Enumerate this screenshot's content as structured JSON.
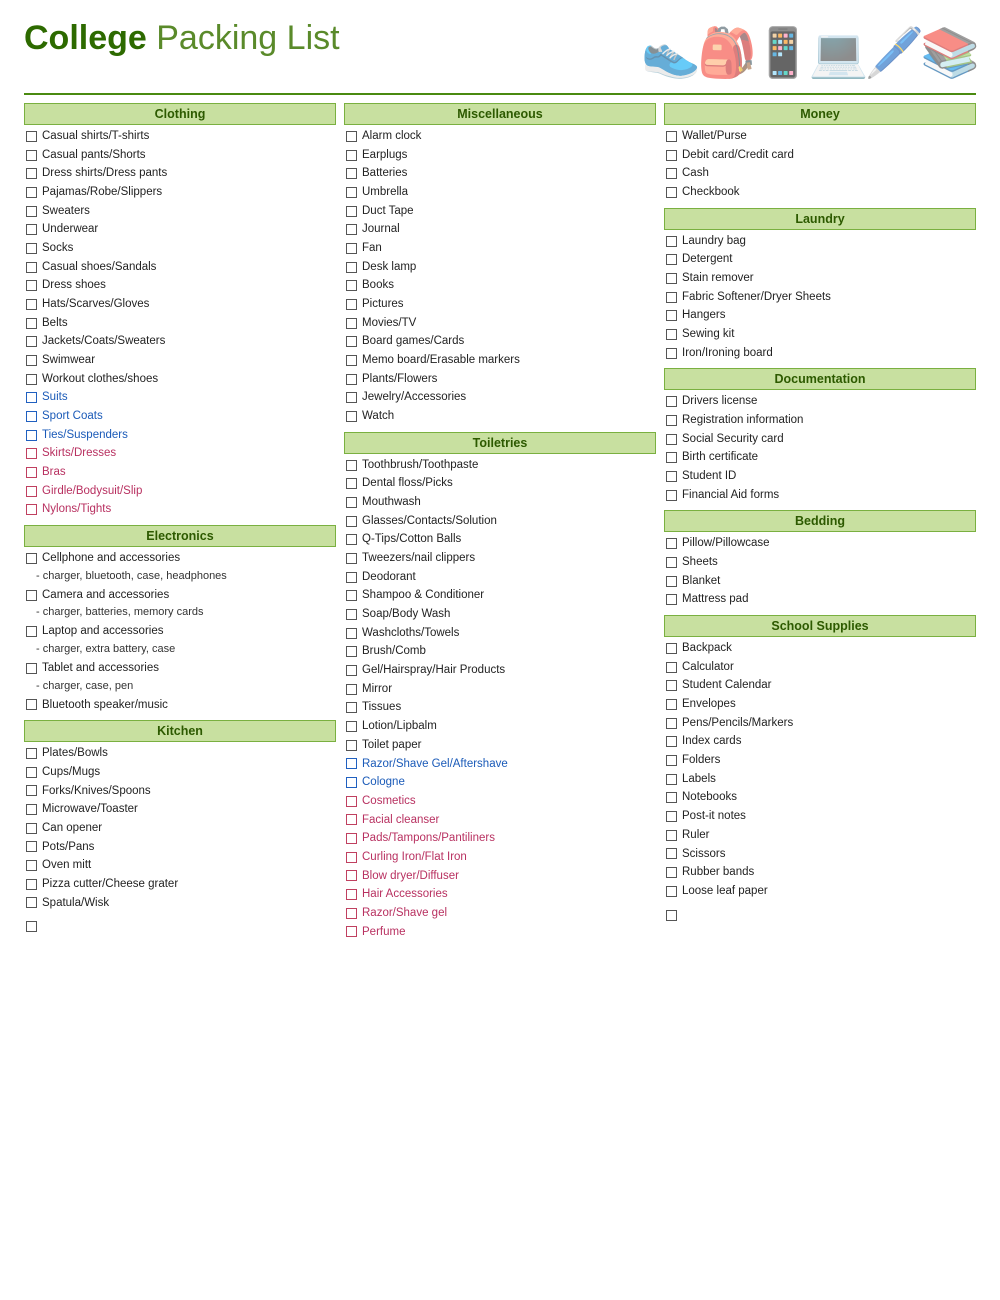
{
  "header": {
    "title_bold": "College",
    "title_light": " Packing List"
  },
  "columns": {
    "col1": {
      "sections": [
        {
          "id": "clothing",
          "header": "Clothing",
          "items": [
            {
              "text": "Casual shirts/T-shirts",
              "style": "normal"
            },
            {
              "text": "Casual pants/Shorts",
              "style": "normal"
            },
            {
              "text": "Dress shirts/Dress pants",
              "style": "normal"
            },
            {
              "text": "Pajamas/Robe/Slippers",
              "style": "normal"
            },
            {
              "text": "Sweaters",
              "style": "normal"
            },
            {
              "text": "Underwear",
              "style": "normal"
            },
            {
              "text": "Socks",
              "style": "normal"
            },
            {
              "text": "Casual shoes/Sandals",
              "style": "normal"
            },
            {
              "text": "Dress shoes",
              "style": "normal"
            },
            {
              "text": "Hats/Scarves/Gloves",
              "style": "normal"
            },
            {
              "text": "Belts",
              "style": "normal"
            },
            {
              "text": "Jackets/Coats/Sweaters",
              "style": "normal"
            },
            {
              "text": "Swimwear",
              "style": "normal"
            },
            {
              "text": "Workout clothes/shoes",
              "style": "normal"
            },
            {
              "text": "Suits",
              "style": "blue"
            },
            {
              "text": "Sport Coats",
              "style": "blue"
            },
            {
              "text": "Ties/Suspenders",
              "style": "blue"
            },
            {
              "text": "Skirts/Dresses",
              "style": "pink"
            },
            {
              "text": "Bras",
              "style": "pink"
            },
            {
              "text": "Girdle/Bodysuit/Slip",
              "style": "pink"
            },
            {
              "text": "Nylons/Tights",
              "style": "pink"
            }
          ]
        },
        {
          "id": "electronics",
          "header": "Electronics",
          "items": [
            {
              "text": "Cellphone and accessories",
              "style": "normal"
            },
            {
              "text": " - charger, bluetooth, case, headphones",
              "style": "indent"
            },
            {
              "text": "Camera and accessories",
              "style": "normal"
            },
            {
              "text": " - charger, batteries, memory cards",
              "style": "indent"
            },
            {
              "text": "Laptop and accessories",
              "style": "normal"
            },
            {
              "text": " - charger, extra battery, case",
              "style": "indent"
            },
            {
              "text": "Tablet and accessories",
              "style": "normal"
            },
            {
              "text": " - charger, case, pen",
              "style": "indent"
            },
            {
              "text": "Bluetooth speaker/music",
              "style": "normal"
            }
          ]
        },
        {
          "id": "kitchen",
          "header": "Kitchen",
          "items": [
            {
              "text": "Plates/Bowls",
              "style": "normal"
            },
            {
              "text": "Cups/Mugs",
              "style": "normal"
            },
            {
              "text": "Forks/Knives/Spoons",
              "style": "normal"
            },
            {
              "text": "Microwave/Toaster",
              "style": "normal"
            },
            {
              "text": "Can opener",
              "style": "normal"
            },
            {
              "text": "Pots/Pans",
              "style": "normal"
            },
            {
              "text": "Oven mitt",
              "style": "normal"
            },
            {
              "text": "Pizza cutter/Cheese grater",
              "style": "normal"
            },
            {
              "text": "Spatula/Wisk",
              "style": "normal"
            }
          ]
        }
      ]
    },
    "col2": {
      "sections": [
        {
          "id": "miscellaneous",
          "header": "Miscellaneous",
          "items": [
            {
              "text": "Alarm clock",
              "style": "normal"
            },
            {
              "text": "Earplugs",
              "style": "normal"
            },
            {
              "text": "Batteries",
              "style": "normal"
            },
            {
              "text": "Umbrella",
              "style": "normal"
            },
            {
              "text": "Duct Tape",
              "style": "normal"
            },
            {
              "text": "Journal",
              "style": "normal"
            },
            {
              "text": "Fan",
              "style": "normal"
            },
            {
              "text": "Desk lamp",
              "style": "normal"
            },
            {
              "text": "Books",
              "style": "normal"
            },
            {
              "text": "Pictures",
              "style": "normal"
            },
            {
              "text": "Movies/TV",
              "style": "normal"
            },
            {
              "text": "Board games/Cards",
              "style": "normal"
            },
            {
              "text": "Memo board/Erasable markers",
              "style": "normal"
            },
            {
              "text": "Plants/Flowers",
              "style": "normal"
            },
            {
              "text": "Jewelry/Accessories",
              "style": "normal"
            },
            {
              "text": "Watch",
              "style": "normal"
            }
          ]
        },
        {
          "id": "toiletries",
          "header": "Toiletries",
          "items": [
            {
              "text": "Toothbrush/Toothpaste",
              "style": "normal"
            },
            {
              "text": "Dental floss/Picks",
              "style": "normal"
            },
            {
              "text": "Mouthwash",
              "style": "normal"
            },
            {
              "text": "Glasses/Contacts/Solution",
              "style": "normal"
            },
            {
              "text": "Q-Tips/Cotton Balls",
              "style": "normal"
            },
            {
              "text": "Tweezers/nail clippers",
              "style": "normal"
            },
            {
              "text": "Deodorant",
              "style": "normal"
            },
            {
              "text": "Shampoo & Conditioner",
              "style": "normal"
            },
            {
              "text": "Soap/Body Wash",
              "style": "normal"
            },
            {
              "text": "Washcloths/Towels",
              "style": "normal"
            },
            {
              "text": "Brush/Comb",
              "style": "normal"
            },
            {
              "text": "Gel/Hairspray/Hair Products",
              "style": "normal"
            },
            {
              "text": "Mirror",
              "style": "normal"
            },
            {
              "text": "Tissues",
              "style": "normal"
            },
            {
              "text": "Lotion/Lipbalm",
              "style": "normal"
            },
            {
              "text": "Toilet paper",
              "style": "normal"
            },
            {
              "text": "Razor/Shave Gel/Aftershave",
              "style": "blue"
            },
            {
              "text": "Cologne",
              "style": "blue"
            },
            {
              "text": "Cosmetics",
              "style": "pink"
            },
            {
              "text": "Facial cleanser",
              "style": "pink"
            },
            {
              "text": "Pads/Tampons/Pantiliners",
              "style": "pink"
            },
            {
              "text": "Curling Iron/Flat Iron",
              "style": "pink"
            },
            {
              "text": "Blow dryer/Diffuser",
              "style": "pink"
            },
            {
              "text": "Hair Accessories",
              "style": "pink"
            },
            {
              "text": "Razor/Shave gel",
              "style": "pink"
            },
            {
              "text": "Perfume",
              "style": "pink"
            }
          ]
        }
      ]
    },
    "col3": {
      "sections": [
        {
          "id": "money",
          "header": "Money",
          "items": [
            {
              "text": "Wallet/Purse",
              "style": "normal"
            },
            {
              "text": "Debit card/Credit card",
              "style": "normal"
            },
            {
              "text": "Cash",
              "style": "normal"
            },
            {
              "text": "Checkbook",
              "style": "normal"
            }
          ]
        },
        {
          "id": "laundry",
          "header": "Laundry",
          "items": [
            {
              "text": "Laundry bag",
              "style": "normal"
            },
            {
              "text": "Detergent",
              "style": "normal"
            },
            {
              "text": "Stain remover",
              "style": "normal"
            },
            {
              "text": "Fabric Softener/Dryer Sheets",
              "style": "normal"
            },
            {
              "text": "Hangers",
              "style": "normal"
            },
            {
              "text": "Sewing kit",
              "style": "normal"
            },
            {
              "text": "Iron/Ironing board",
              "style": "normal"
            }
          ]
        },
        {
          "id": "documentation",
          "header": "Documentation",
          "items": [
            {
              "text": "Drivers license",
              "style": "normal"
            },
            {
              "text": "Registration information",
              "style": "normal"
            },
            {
              "text": "Social Security card",
              "style": "normal"
            },
            {
              "text": "Birth certificate",
              "style": "normal"
            },
            {
              "text": "Student ID",
              "style": "normal"
            },
            {
              "text": "Financial Aid forms",
              "style": "normal"
            }
          ]
        },
        {
          "id": "bedding",
          "header": "Bedding",
          "items": [
            {
              "text": "Pillow/Pillowcase",
              "style": "normal"
            },
            {
              "text": "Sheets",
              "style": "normal"
            },
            {
              "text": "Blanket",
              "style": "normal"
            },
            {
              "text": "Mattress pad",
              "style": "normal"
            }
          ]
        },
        {
          "id": "school-supplies",
          "header": "School Supplies",
          "items": [
            {
              "text": "Backpack",
              "style": "normal"
            },
            {
              "text": "Calculator",
              "style": "normal"
            },
            {
              "text": "Student Calendar",
              "style": "normal"
            },
            {
              "text": "Envelopes",
              "style": "normal"
            },
            {
              "text": "Pens/Pencils/Markers",
              "style": "normal"
            },
            {
              "text": "Index cards",
              "style": "normal"
            },
            {
              "text": "Folders",
              "style": "normal"
            },
            {
              "text": "Labels",
              "style": "normal"
            },
            {
              "text": "Notebooks",
              "style": "normal"
            },
            {
              "text": "Post-it notes",
              "style": "normal"
            },
            {
              "text": "Ruler",
              "style": "normal"
            },
            {
              "text": "Scissors",
              "style": "normal"
            },
            {
              "text": "Rubber bands",
              "style": "normal"
            },
            {
              "text": "Loose leaf paper",
              "style": "normal"
            }
          ]
        }
      ]
    }
  }
}
